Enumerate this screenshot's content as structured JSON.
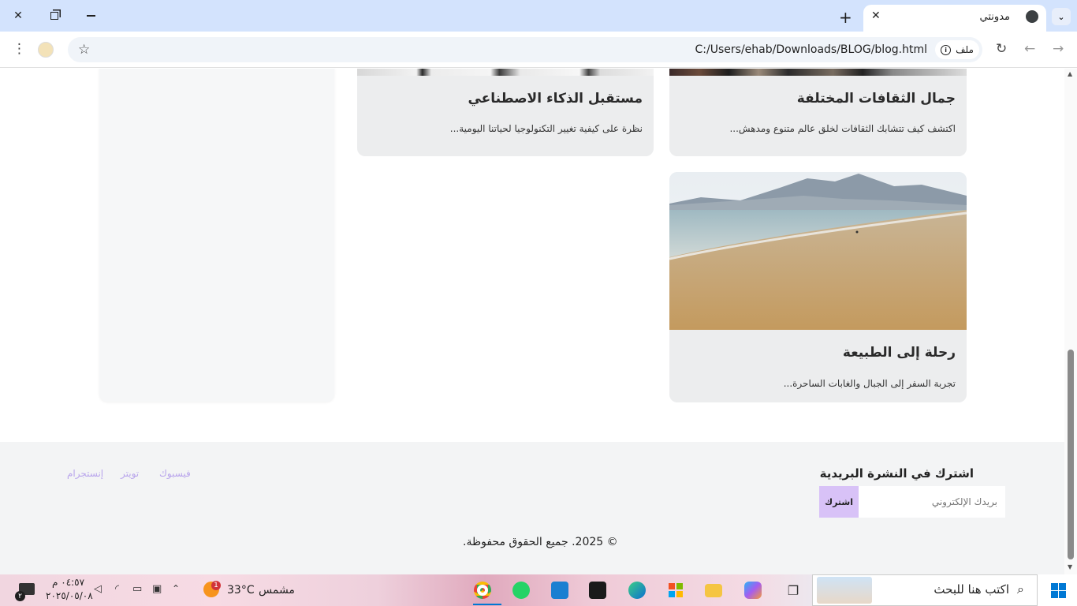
{
  "browser": {
    "tab_title": "مدونتي",
    "url": "C:/Users/ehab/Downloads/BLOG/blog.html",
    "file_chip": "ملف",
    "icons": [
      "close-icon",
      "restore-icon",
      "minimize-icon",
      "new-tab-icon",
      "globe-icon",
      "tab-search-icon",
      "back-icon",
      "forward-icon",
      "reload-icon",
      "star-icon",
      "menu-icon",
      "profile-icon"
    ]
  },
  "posts": [
    {
      "title": "مستقبل الذكاء الاصطناعي",
      "desc": "نظرة على كيفية تغيير التكنولوجيا لحياتنا اليومية..."
    },
    {
      "title": "جمال الثقافات المختلفة",
      "desc": "اكتشف كيف تتشابك الثقافات لخلق عالم متنوع ومدهش..."
    },
    {
      "title": "رحلة إلى الطبيعة",
      "desc": "تجربة السفر إلى الجبال والغابات الساحرة..."
    }
  ],
  "footer": {
    "newsletter_title": "اشترك في النشرة البريدية",
    "email_placeholder": "بريدك الإلكتروني",
    "subscribe_label": "اشترك",
    "social": [
      "فيسبوك",
      "تويتر",
      "إنستجرام"
    ],
    "copyright": "© 2025. جميع الحقوق محفوظة."
  },
  "taskbar": {
    "search_placeholder": "اكتب هنا للبحث",
    "weather_temp": "33°C",
    "weather_label": "مشمس",
    "weather_badge": "1",
    "time": "٠٤:٥٧ م",
    "date": "٢٠٢٥/٠٥/٠٨",
    "notification_count": "٢",
    "accent_color": "#d8c2f7"
  }
}
